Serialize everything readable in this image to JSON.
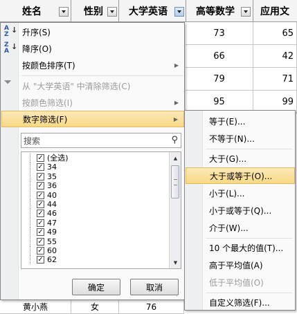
{
  "headers": [
    {
      "label": "姓名"
    },
    {
      "label": "性别"
    },
    {
      "label": "大学英语"
    },
    {
      "label": "高等数学"
    },
    {
      "label": "应用文"
    }
  ],
  "grid_values": {
    "math": [
      "73",
      "66",
      "79",
      "95"
    ],
    "writing": [
      "65",
      "42",
      "71",
      "99"
    ],
    "bottom_row": {
      "name": "黄小燕",
      "gender": "女",
      "english": "76"
    }
  },
  "menu": {
    "sort_asc": "升序(S)",
    "sort_desc": "降序(O)",
    "sort_by_color": "按颜色排序(T)",
    "clear_filter": "从 \"大学英语\" 中清除筛选(C)",
    "filter_by_color": "按颜色筛选(I)",
    "number_filter": "数字筛选(F)",
    "search_placeholder": "搜索",
    "ok": "确定",
    "cancel": "取消"
  },
  "values_list": [
    "(全选)",
    "34",
    "35",
    "36",
    "40",
    "44",
    "46",
    "47",
    "49",
    "55",
    "60",
    "62"
  ],
  "submenu": {
    "equals": "等于(E)...",
    "not_equals": "不等于(N)...",
    "greater": "大于(G)...",
    "greater_equal": "大于或等于(O)...",
    "less": "小于(L)...",
    "less_equal": "小于或等于(Q)...",
    "between": "介于(W)...",
    "top10": "10 个最大的值(T)...",
    "above_avg": "高于平均值(A)",
    "below_avg": "低于平均值(O)",
    "custom": "自定义筛选(F)..."
  },
  "icons": {
    "sort_asc": "az-down-icon",
    "sort_desc": "za-down-icon",
    "clear_filter": "funnel-clear-icon",
    "search": "search-icon"
  }
}
